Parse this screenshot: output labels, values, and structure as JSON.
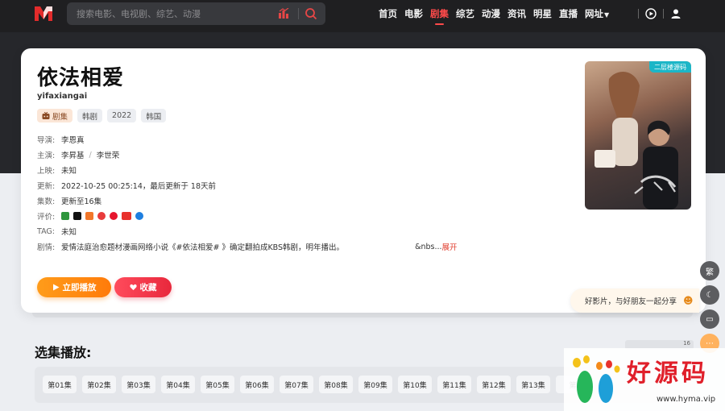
{
  "header": {
    "search_placeholder": "搜索电影、电视剧、综艺、动漫",
    "nav": [
      {
        "label": "首页",
        "active": false
      },
      {
        "label": "电影",
        "active": false
      },
      {
        "label": "剧集",
        "active": true
      },
      {
        "label": "综艺",
        "active": false
      },
      {
        "label": "动漫",
        "active": false
      },
      {
        "label": "资讯",
        "active": false
      },
      {
        "label": "明星",
        "active": false
      },
      {
        "label": "直播",
        "active": false
      },
      {
        "label": "网址",
        "active": false
      }
    ]
  },
  "detail": {
    "title": "依法相爱",
    "subtitle": "yifaxiangai",
    "tags": [
      "剧集",
      "韩剧",
      "2022",
      "韩国"
    ],
    "director_label": "导演:",
    "director": "李恩真",
    "cast_label": "主演:",
    "cast": [
      "李昇基",
      "李世荣"
    ],
    "release_label": "上映:",
    "release": "未知",
    "update_label": "更新:",
    "update": "2022-10-25 00:25:14，最后更新于 18天前",
    "episodes_label": "集数:",
    "episodes": "更新至16集",
    "rating_label": "评价:",
    "tag_label": "TAG:",
    "tag_value": "未知",
    "plot_label": "剧情:",
    "plot": "爱情法庭治愈题材漫画网络小说《#依法相爱# 》确定翻拍成KBS韩剧，明年播出。",
    "plot_tail": "&nbs...",
    "plot_more": "展开",
    "play_button": "立即播放",
    "fav_button": "收藏",
    "poster_badge": "二层楼源码"
  },
  "side": {
    "share_text": "好影片，与好朋友一起分享",
    "trad_label": "繁"
  },
  "episodes_section": {
    "title": "选集播放:",
    "sort_label": "16",
    "items": [
      "第01集",
      "第02集",
      "第03集",
      "第04集",
      "第05集",
      "第06集",
      "第07集",
      "第08集",
      "第09集",
      "第10集",
      "第11集",
      "第12集",
      "第13集",
      "第"
    ]
  },
  "watermark": {
    "text": "好源码",
    "url": "www.hyma.vip"
  },
  "colors": {
    "accent_red": "#ff4a4a",
    "play_orange": "#ff8c14",
    "header_bg": "#1f1f21"
  }
}
